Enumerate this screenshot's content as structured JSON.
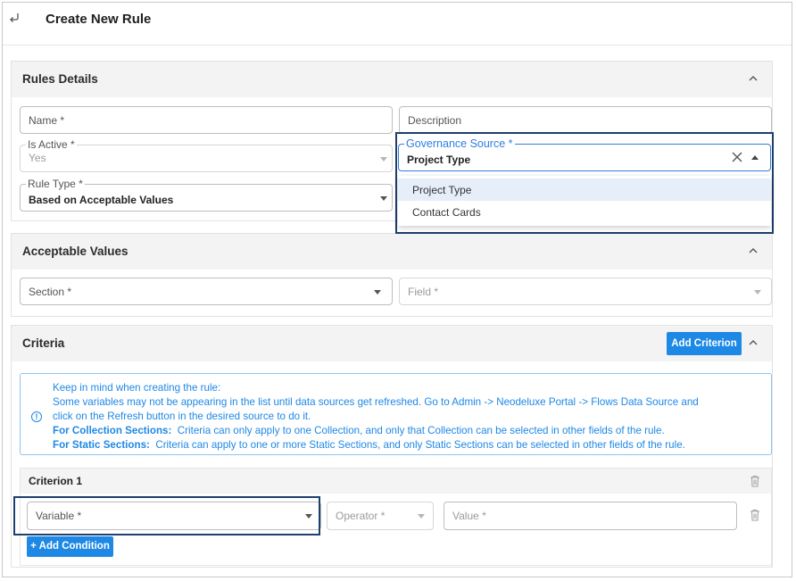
{
  "header": {
    "title": "Create New Rule",
    "back_icon": "back-arrow-icon"
  },
  "rules_details": {
    "title": "Rules Details",
    "name_field": {
      "placeholder": "Name *"
    },
    "description_field": {
      "placeholder": "Description"
    },
    "is_active": {
      "label": "Is Active *",
      "value": "Yes"
    },
    "governance_source": {
      "label": "Governance Source *",
      "value": "Project Type",
      "options": [
        "Project Type",
        "Contact Cards"
      ],
      "selected": "Project Type"
    },
    "rule_type": {
      "label": "Rule Type *",
      "value": "Based on Acceptable Values"
    }
  },
  "acceptable_values": {
    "title": "Acceptable Values",
    "section_field": {
      "placeholder": "Section *"
    },
    "field_field": {
      "placeholder": "Field *"
    }
  },
  "criteria": {
    "title": "Criteria",
    "add_criterion_label": "Add Criterion",
    "info": {
      "line1": "Keep in mind when creating the rule:",
      "line2": "Some variables may not be appearing in the list until data sources get refreshed. Go to Admin -> Neodeluxe Portal -> Flows Data Source and",
      "line3": "click on the Refresh button in the desired source to do it.",
      "collection_title": "For Collection Sections:",
      "collection_text": "Criteria can only apply to one Collection, and only that Collection can be selected in other fields of the rule.",
      "static_title": "For Static Sections:",
      "static_text": "Criteria can apply to one or more Static Sections, and only Static Sections can be selected in other fields of the rule."
    },
    "criterion": {
      "title": "Criterion 1",
      "variable_placeholder": "Variable *",
      "operator_placeholder": "Operator *",
      "value_placeholder": "Value *",
      "add_condition_label": "+ Add Condition"
    }
  },
  "colors": {
    "accent": "#1e88e5",
    "highlight_border": "#1d3f6e",
    "header_bg": "#f3f3f3"
  }
}
